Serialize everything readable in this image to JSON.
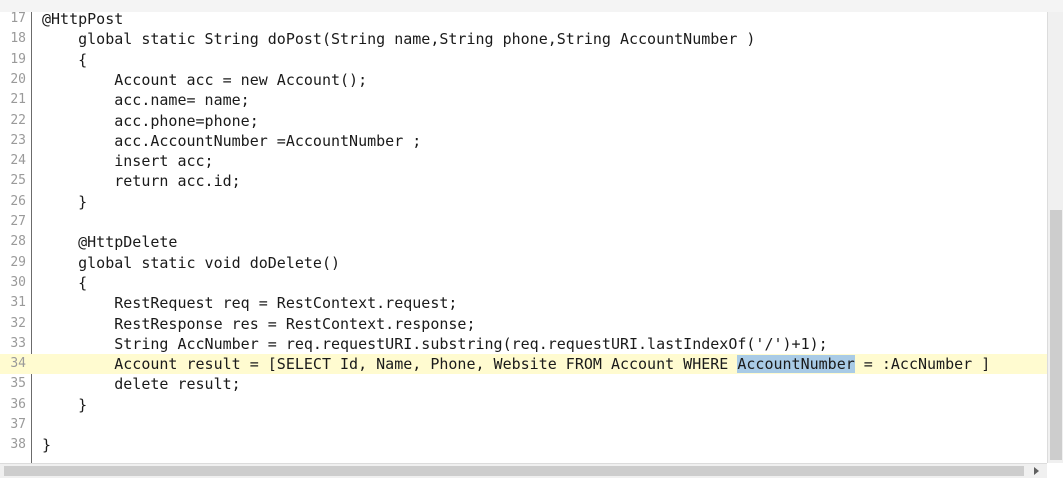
{
  "editor": {
    "lines": [
      {
        "num": "17",
        "text": "@HttpPost"
      },
      {
        "num": "18",
        "text": "    global static String doPost(String name,String phone,String AccountNumber )"
      },
      {
        "num": "19",
        "text": "    {"
      },
      {
        "num": "20",
        "text": "        Account acc = new Account();"
      },
      {
        "num": "21",
        "text": "        acc.name= name;"
      },
      {
        "num": "22",
        "text": "        acc.phone=phone;"
      },
      {
        "num": "23",
        "text": "        acc.AccountNumber =AccountNumber ;"
      },
      {
        "num": "24",
        "text": "        insert acc;"
      },
      {
        "num": "25",
        "text": "        return acc.id;"
      },
      {
        "num": "26",
        "text": "    }"
      },
      {
        "num": "27",
        "text": ""
      },
      {
        "num": "28",
        "text": "    @HttpDelete"
      },
      {
        "num": "29",
        "text": "    global static void doDelete()"
      },
      {
        "num": "30",
        "text": "    {"
      },
      {
        "num": "31",
        "text": "        RestRequest req = RestContext.request;"
      },
      {
        "num": "32",
        "text": "        RestResponse res = RestContext.response;"
      },
      {
        "num": "33",
        "text": "        String AccNumber = req.requestURI.substring(req.requestURI.lastIndexOf('/')+1);"
      },
      {
        "num": "34",
        "before": "        Account result = [SELECT Id, Name, Phone, Website FROM Account WHERE ",
        "highlight": "AccountNumber",
        "after": " = :AccNumber ]",
        "current": true
      },
      {
        "num": "35",
        "text": "        delete result;"
      },
      {
        "num": "36",
        "text": "    }"
      },
      {
        "num": "37",
        "text": ""
      },
      {
        "num": "38",
        "text": "}"
      }
    ],
    "colors": {
      "current_line": "#fffbd0",
      "selection": "#a9cbe6",
      "line_number": "#9a9a9a",
      "gutter_border": "#6b6b6b"
    }
  },
  "scrollbars": {
    "right_arrow_icon": "triangle-right"
  }
}
